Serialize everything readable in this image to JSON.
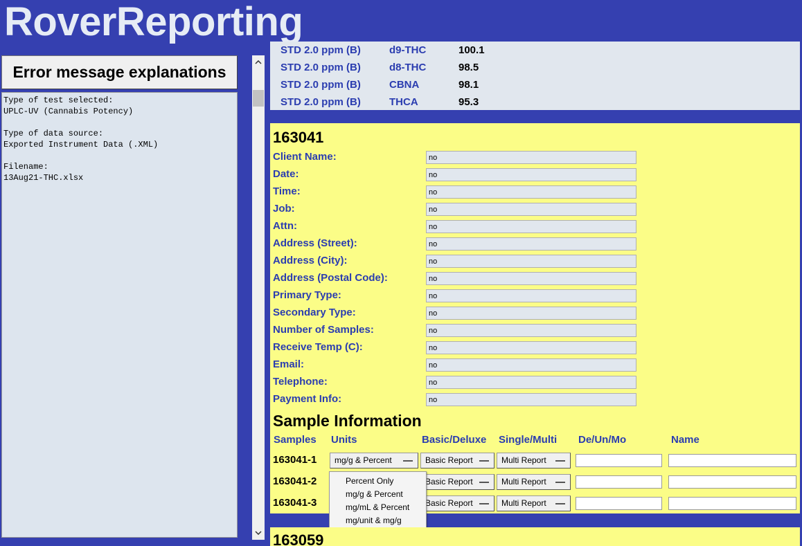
{
  "app": {
    "title": "RoverReporting"
  },
  "left_panel": {
    "button_label": "Error message explanations",
    "text": "Type of test selected:\nUPLC-UV (Cannabis Potency)\n\nType of data source:\nExported Instrument Data (.XML)\n\nFilename:\n13Aug21-THC.xlsx"
  },
  "scrollbar": {
    "up_icon": "chevron-up",
    "down_icon": "chevron-down"
  },
  "standards": [
    {
      "std": "STD 2.0 ppm (B)",
      "analyte": "d9-THC",
      "value": "100.1"
    },
    {
      "std": "STD 2.0 ppm (B)",
      "analyte": "d8-THC",
      "value": "98.5"
    },
    {
      "std": "STD 2.0 ppm (B)",
      "analyte": "CBNA",
      "value": "98.1"
    },
    {
      "std": "STD 2.0 ppm (B)",
      "analyte": "THCA",
      "value": "95.3"
    }
  ],
  "sample_panel": {
    "id": "163041",
    "fields": [
      {
        "label": "Client Name:",
        "value": "no"
      },
      {
        "label": "Date:",
        "value": "no"
      },
      {
        "label": "Time:",
        "value": "no"
      },
      {
        "label": "Job:",
        "value": "no"
      },
      {
        "label": "Attn:",
        "value": "no"
      },
      {
        "label": "Address (Street):",
        "value": "no"
      },
      {
        "label": "Address (City):",
        "value": "no"
      },
      {
        "label": "Address (Postal Code):",
        "value": "no"
      },
      {
        "label": "Primary Type:",
        "value": "no"
      },
      {
        "label": "Secondary Type:",
        "value": "no"
      },
      {
        "label": "Number of Samples:",
        "value": "no"
      },
      {
        "label": "Receive Temp (C):",
        "value": "no"
      },
      {
        "label": "Email:",
        "value": "no"
      },
      {
        "label": "Telephone:",
        "value": "no"
      },
      {
        "label": "Payment Info:",
        "value": "no"
      }
    ],
    "sample_info_title": "Sample Information",
    "columns": [
      "Samples",
      "Units",
      "Basic/Deluxe",
      "Single/Multi",
      "De/Un/Mo",
      "Name"
    ],
    "samples": [
      {
        "id": "163041-1",
        "units": "mg/g & Percent",
        "report": "Basic Report",
        "multi": "Multi Report",
        "deunmo": "",
        "name": ""
      },
      {
        "id": "163041-2",
        "units": "",
        "report": "Basic Report",
        "multi": "Multi Report",
        "deunmo": "",
        "name": ""
      },
      {
        "id": "163041-3",
        "units": "",
        "report": "Basic Report",
        "multi": "Multi Report",
        "deunmo": "",
        "name": ""
      }
    ]
  },
  "units_dropdown": {
    "options": [
      "Percent Only",
      "mg/g & Percent",
      "mg/mL & Percent",
      "mg/unit & mg/g"
    ]
  },
  "next_panel": {
    "id": "163059"
  }
}
